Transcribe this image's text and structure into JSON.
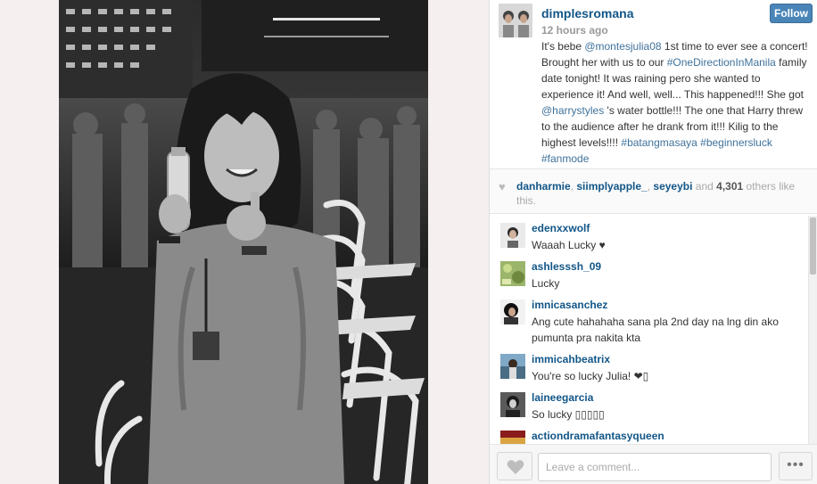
{
  "post": {
    "username": "dimplesromana",
    "time": "12 hours ago",
    "follow_label": "Follow",
    "caption": {
      "t1": "It's bebe ",
      "m1": "@montesjulia08",
      "t2": " 1st time to ever see a concert! Brought her with us to our ",
      "h1": "#OneDirectionInManila",
      "t3": " family date tonight! It was raining pero she wanted to experience it! And well, well... This happened!!! She got ",
      "m2": "@harrystyles",
      "t4": " 's water bottle!!! The one that Harry threw to the audience after he drank from it!!! Kilig to the highest levels!!!! ",
      "h2": "#batangmasaya",
      "s1": " ",
      "h3": "#beginnersluck",
      "s2": " ",
      "h4": "#fanmode"
    }
  },
  "likes": {
    "liker1": "danharmie",
    "sep1": ", ",
    "liker2": "siimplyapple_",
    "sep2": ", ",
    "liker3": "seyeybi",
    "and": " and ",
    "count": "4,301",
    "suffix": " others like this."
  },
  "comments": [
    {
      "user": "edenxxwolf",
      "text": "Waaah Lucky ♥"
    },
    {
      "user": "ashlesssh_09",
      "text": "Lucky"
    },
    {
      "user": "imnicasanchez",
      "text": "Ang cute hahahaha sana pla 2nd day na lng din ako pumunta pra nakita kta"
    },
    {
      "user": "immicahbeatrix",
      "text": "You're so lucky Julia! ❤▯"
    },
    {
      "user": "laineegarcia",
      "text": "So lucky ▯▯▯▯▯"
    },
    {
      "user": "actiondramafantasyqueen",
      "text": ""
    }
  ],
  "footer": {
    "comment_placeholder": "Leave a comment...",
    "more_label": "•••"
  },
  "icons": {
    "like": "heart-icon",
    "likes_heart": "heart-icon",
    "more": "ellipsis-icon"
  },
  "colors": {
    "username": "#125688",
    "link": "#3f729b",
    "follow_button": "#4a85b8"
  }
}
